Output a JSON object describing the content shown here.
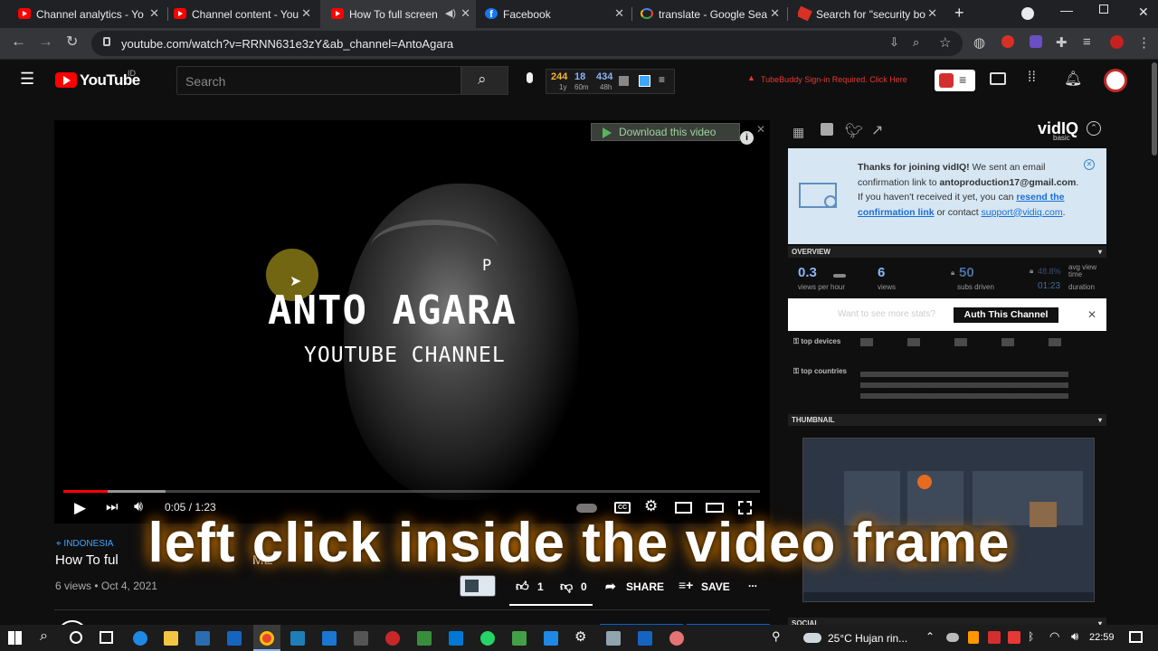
{
  "browser": {
    "tabs": [
      {
        "title": "Channel analytics - Yo",
        "icon": "youtube-icon"
      },
      {
        "title": "Channel content - You",
        "icon": "youtube-icon"
      },
      {
        "title": "How To full screen",
        "icon": "youtube-icon",
        "active": true
      },
      {
        "title": "Facebook",
        "icon": "facebook-icon"
      },
      {
        "title": "translate - Google Sea",
        "icon": "google-icon"
      },
      {
        "title": "Search for \"security bo",
        "icon": "pen-icon"
      }
    ],
    "url": "youtube.com/watch?v=RRNN631e3zY&ab_channel=AntoAgara"
  },
  "youtube": {
    "logo_text": "YouTube",
    "region": "ID",
    "search_placeholder": "Search",
    "ext_stats": {
      "views_1y": "244",
      "views_60m": "18",
      "views_48h": "434",
      "lbl_1y": "1y",
      "lbl_60m": "60m",
      "lbl_48h": "48h"
    },
    "tubebuddy_warning": "TubeBuddy Sign-in Required. Click Here"
  },
  "video": {
    "overlay_title": "ANTO AGARA",
    "overlay_subtitle": "YOUTUBE CHANNEL",
    "overlay_letter": "P",
    "download_label": "Download this video",
    "timecode": "0:05 / 1:23",
    "progress_fraction": 0.063,
    "caption": "left click inside the video frame"
  },
  "below": {
    "location_chip": "INDONESIA",
    "title": "How To ful",
    "title_tail": "ME",
    "meta": "6 views • Oct 4, 2021",
    "likes": "1",
    "dislikes": "0",
    "share": "SHARE",
    "save": "SAVE",
    "more": "..."
  },
  "vidiq": {
    "logo": "vidIQ",
    "plan": "basic",
    "notice_bold1": "Thanks for joining vidIQ!",
    "notice_text1": " We sent an email confirmation link to ",
    "notice_email": "antoproduction17@gmail.com",
    "notice_text2": ". If you haven't received it yet, you can ",
    "notice_link1": "resend the confirmation link",
    "notice_text3": " or contact ",
    "notice_link2": "support@vidiq.com",
    "notice_text4": ".",
    "overview": "OVERVIEW",
    "vph_value": "0.3",
    "vph_label": "views per hour",
    "views_value": "6",
    "views_label": "views",
    "subs_value": "50",
    "subs_label": "subs driven",
    "pct_value": "48.8%",
    "duration_value": "01:23",
    "avg_label": "avg view time",
    "duration_label": "duration",
    "auth_prompt": "Want to see more stats?",
    "auth_button": "Auth This Channel",
    "top_devices": "top devices",
    "top_countries": "top countries",
    "thumbnail": "THUMBNAIL",
    "social": "SOCIAL"
  },
  "taskbar": {
    "weather": "25°C  Hujan rin...",
    "time": "22:59"
  },
  "colors": {
    "accent_red": "#ff0000",
    "link_blue": "#3ea6ff",
    "vidiq_notice_bg": "#d6e6f2"
  }
}
